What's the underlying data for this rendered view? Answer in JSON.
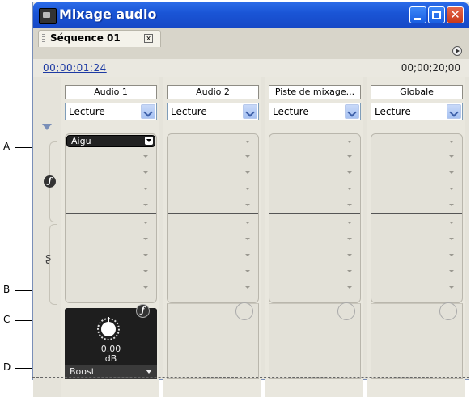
{
  "window": {
    "title": "Mixage audio",
    "minimize_label": "–",
    "maximize_label": "□",
    "close_label": "✕"
  },
  "tab": {
    "label": "Séquence 01",
    "close_label": "x"
  },
  "timecode": {
    "current": "00;00;01;24",
    "duration": "00;00;20;00"
  },
  "tracks": [
    {
      "name": "Audio 1",
      "mode": "Lecture"
    },
    {
      "name": "Audio 2",
      "mode": "Lecture"
    },
    {
      "name": "Piste de mixage...",
      "mode": "Lecture"
    },
    {
      "name": "Globale",
      "mode": "Lecture"
    }
  ],
  "effect": {
    "selected": "Aigu",
    "param_value": "0.00",
    "param_unit": "dB",
    "param_name": "Boost"
  },
  "callouts": {
    "a": "A",
    "b": "B",
    "c": "C",
    "d": "D"
  },
  "icons": {
    "fx": "ƒ",
    "send": "ʂ"
  }
}
